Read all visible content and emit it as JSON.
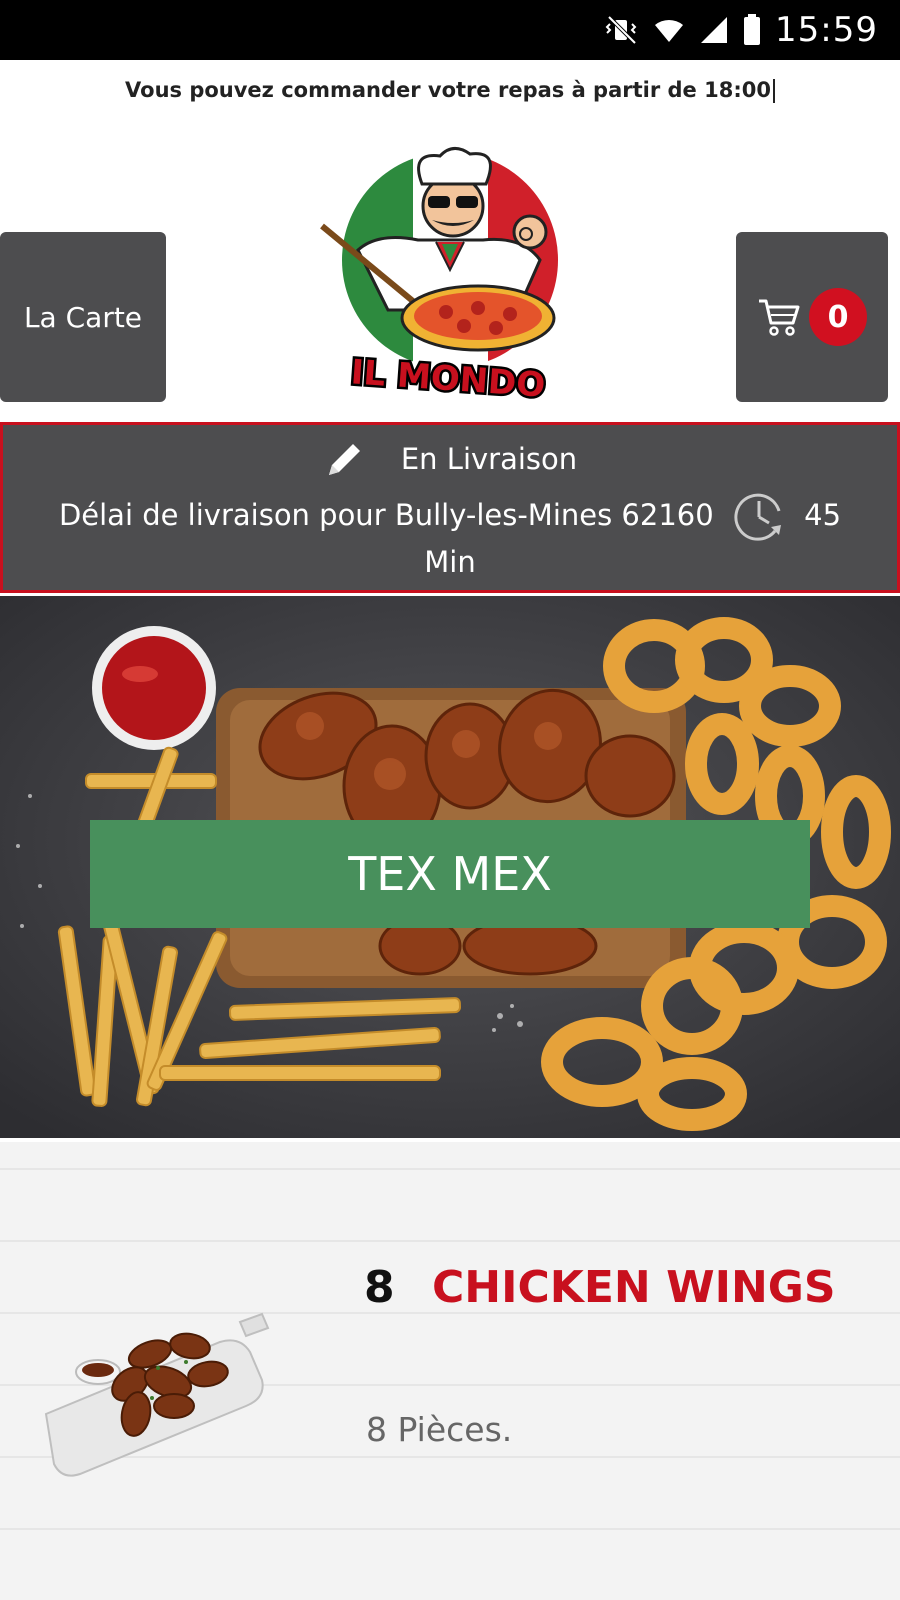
{
  "status_bar": {
    "time": "15:59"
  },
  "notice": {
    "text": "Vous pouvez commander votre repas à partir de 18:00"
  },
  "header": {
    "menu_label": "La Carte",
    "logo_text": "IL MONDO",
    "cart_count": "0"
  },
  "delivery": {
    "mode": "En Livraison",
    "delay_label": "Délai de livraison pour Bully-les-Mines 62160",
    "delay_value": "45",
    "delay_unit": "Min"
  },
  "banner": {
    "category": "TEX MEX"
  },
  "products": [
    {
      "qty": "8",
      "name": "CHICKEN WINGS",
      "description": "8 Pièces."
    }
  ],
  "colors": {
    "accent_red": "#c8101e",
    "button_gray": "#4d4d4f",
    "category_green": "#48905c"
  }
}
